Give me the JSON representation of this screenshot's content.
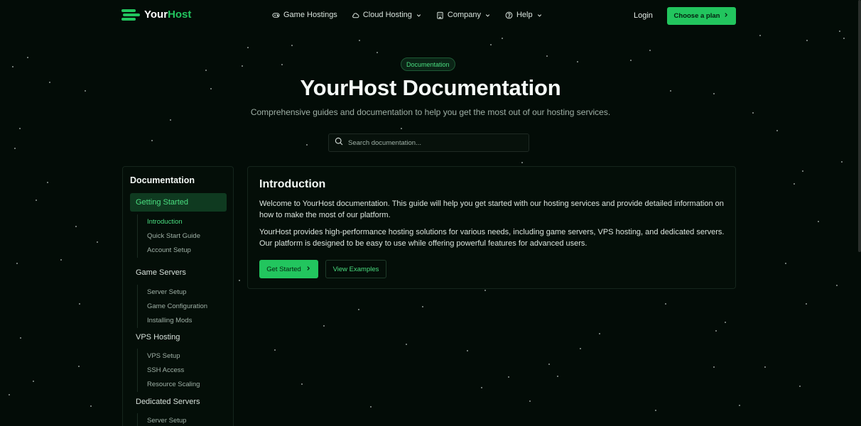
{
  "colors": {
    "accent": "#22c55e",
    "background": "#030c07"
  },
  "header": {
    "logo": {
      "prefix": "Your",
      "suffix": "Host",
      "icon": "logo-stripes-icon"
    },
    "nav": [
      {
        "label": "Game Hostings",
        "icon": "gamepad-icon",
        "dropdown": false
      },
      {
        "label": "Cloud Hosting",
        "icon": "cloud-icon",
        "dropdown": true
      },
      {
        "label": "Company",
        "icon": "building-icon",
        "dropdown": true
      },
      {
        "label": "Help",
        "icon": "help-circle-icon",
        "dropdown": true
      }
    ],
    "login": "Login",
    "cta": "Choose a plan"
  },
  "hero": {
    "badge": "Documentation",
    "title": "YourHost Documentation",
    "subtitle": "Comprehensive guides and documentation to help you get the most out of our hosting services.",
    "search_placeholder": "Search documentation..."
  },
  "sidebar": {
    "title": "Documentation",
    "sections": [
      {
        "label": "Getting Started",
        "active": true,
        "items": [
          "Introduction",
          "Quick Start Guide",
          "Account Setup"
        ],
        "current": "Introduction"
      },
      {
        "label": "Game Servers",
        "active": false,
        "items": [
          "Server Setup",
          "Game Configuration",
          "Installing Mods"
        ]
      },
      {
        "label": "VPS Hosting",
        "active": false,
        "items": [
          "VPS Setup",
          "SSH Access",
          "Resource Scaling"
        ]
      },
      {
        "label": "Dedicated Servers",
        "active": false,
        "items": [
          "Server Setup"
        ]
      }
    ]
  },
  "content": {
    "title": "Introduction",
    "paragraphs": [
      "Welcome to YourHost documentation. This guide will help you get started with our hosting services and provide detailed information on how to make the most of our platform.",
      "YourHost provides high-performance hosting solutions for various needs, including game servers, VPS hosting, and dedicated servers. Our platform is designed to be easy to use while offering powerful features for advanced users."
    ],
    "primary_button": "Get Started",
    "secondary_button": "View Examples"
  }
}
